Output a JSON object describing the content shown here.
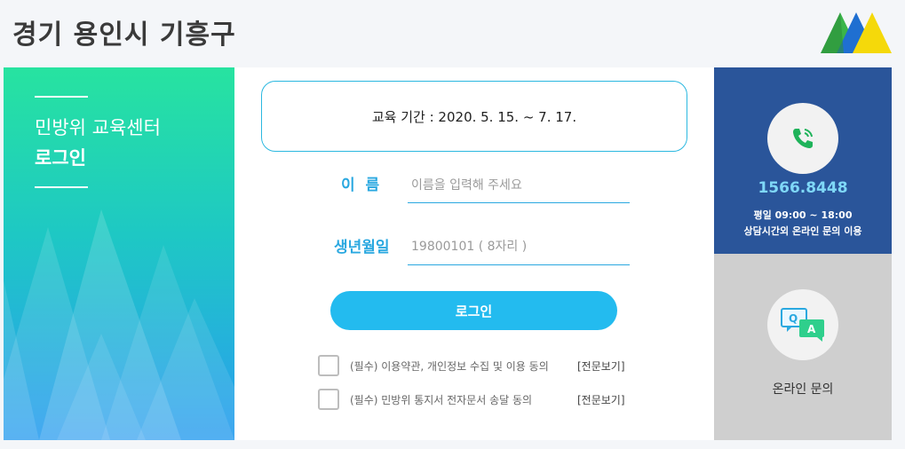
{
  "header": {
    "region_title": "경기 용인시 기흥구"
  },
  "left_panel": {
    "line1": "민방위 교육센터",
    "line2": "로그인"
  },
  "main": {
    "period_text": "교육 기간 : 2020. 5. 15. ~ 7. 17.",
    "name_label": "이  름",
    "name_placeholder": "이름을 입력해 주세요",
    "birth_label": "생년월일",
    "birth_placeholder": "19800101 ( 8자리 )",
    "login_label": "로그인",
    "agreements": [
      {
        "text": "(필수) 이용약관, 개인정보 수집 및 이용 동의",
        "link": "[전문보기]"
      },
      {
        "text": "(필수) 민방위 통지서 전자문서 송달 동의",
        "link": "[전문보기]"
      }
    ]
  },
  "contact": {
    "phone": "1566.8448",
    "hours": "평일 09:00 ~ 18:00",
    "note": "상담시간외 온라인 문의 이용",
    "phone_icon": "phone-icon"
  },
  "inquiry": {
    "label": "온라인 문의",
    "icon": "qa-chat-icon"
  },
  "colors": {
    "accent": "#23bbef",
    "contact_bg": "#2a559a",
    "inquiry_bg": "#cfcfcf",
    "phone_number": "#7fd8f7"
  }
}
